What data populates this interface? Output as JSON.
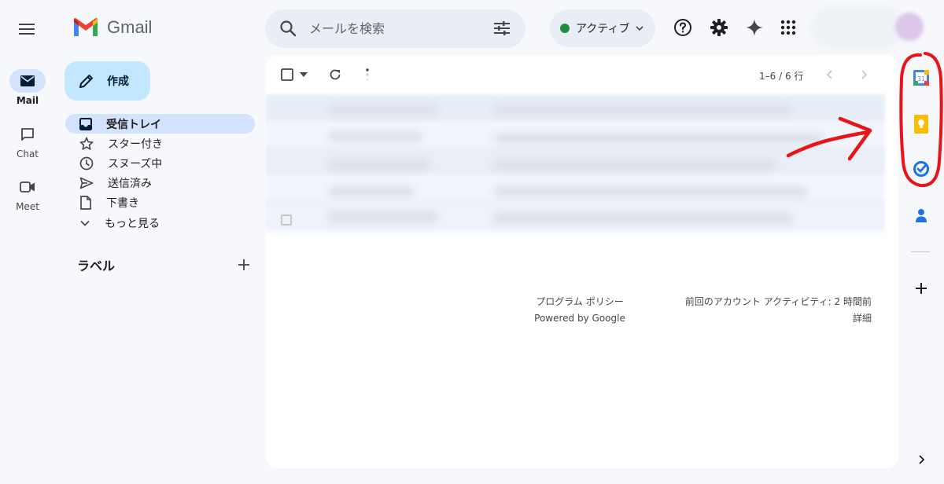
{
  "rail": {
    "items": [
      {
        "label": "Mail",
        "icon": "mail-icon"
      },
      {
        "label": "Chat",
        "icon": "chat-icon"
      },
      {
        "label": "Meet",
        "icon": "video-icon"
      }
    ]
  },
  "header": {
    "logo_text": "Gmail",
    "search_placeholder": "メールを検索",
    "status_label": "アクティブ",
    "status_color": "#1e8e3e"
  },
  "compose": {
    "label": "作成"
  },
  "nav": {
    "items": [
      {
        "label": "受信トレイ",
        "icon": "inbox-icon",
        "active": true
      },
      {
        "label": "スター付き",
        "icon": "star-icon"
      },
      {
        "label": "スヌーズ中",
        "icon": "clock-icon"
      },
      {
        "label": "送信済み",
        "icon": "send-icon"
      },
      {
        "label": "下書き",
        "icon": "draft-icon"
      },
      {
        "label": "もっと見る",
        "icon": "chevron-down-icon"
      }
    ],
    "labels_title": "ラベル"
  },
  "main": {
    "page_info": "1–6 / 6 行",
    "footer_left": [
      "プログラム ポリシー",
      "Powered by Google"
    ],
    "footer_right": [
      "前回のアカウント アクティビティ: 2 時間前",
      "詳細"
    ]
  },
  "side_panel": {
    "icons": [
      "calendar-icon",
      "keep-icon",
      "tasks-icon",
      "contacts-icon",
      "add-icon"
    ],
    "calendar_day": "31"
  },
  "colors": {
    "accent": "#c2e7ff",
    "active_nav": "#d3e3fd",
    "annotation": "#e8141a"
  }
}
